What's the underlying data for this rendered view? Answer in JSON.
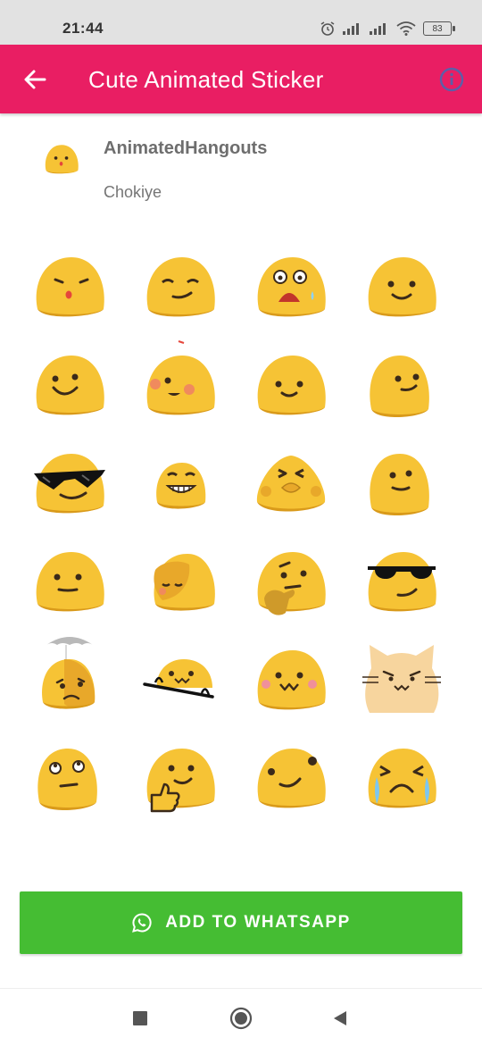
{
  "status_bar": {
    "time": "21:44",
    "battery": "83",
    "icons": [
      "alarm-icon",
      "signal-icon",
      "signal-icon",
      "wifi-icon",
      "battery-icon"
    ]
  },
  "app_bar": {
    "title": "Cute Animated Sticker",
    "back_icon": "arrow-back-icon",
    "info_icon": "info-icon",
    "color": "#e91e63"
  },
  "pack": {
    "name": "AnimatedHangouts",
    "publisher": "Chokiye"
  },
  "stickers": [
    "blob-kiss",
    "blob-smirk",
    "blob-scared",
    "blob-smile",
    "blob-happy",
    "blob-blush",
    "blob-smile-2",
    "blob-side-smile",
    "blob-sunglasses-grin",
    "blob-grin",
    "blob-pray",
    "blob-side-smile-2",
    "blob-neutral-smile",
    "blob-sleep",
    "blob-thinking",
    "blob-sunglasses",
    "blob-umbrella",
    "blob-peek",
    "blob-uwu",
    "blob-cat",
    "blob-eyeroll",
    "blob-thumbsup",
    "blob-wink",
    "blob-cry"
  ],
  "add_button": {
    "label": "ADD TO WHATSAPP",
    "icon": "whatsapp-icon",
    "color": "#45bd33"
  },
  "nav_bar": {
    "icons": [
      "recents-square-icon",
      "home-circle-icon",
      "back-triangle-icon"
    ]
  }
}
